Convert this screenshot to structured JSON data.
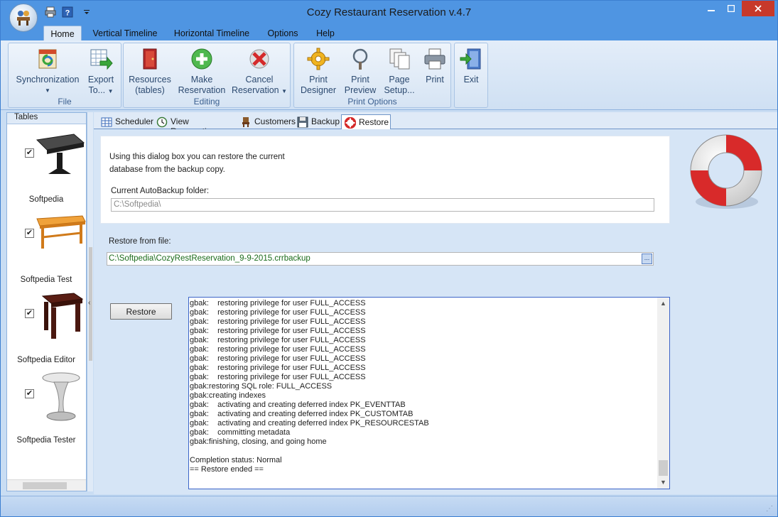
{
  "window": {
    "title": "Cozy Restaurant Reservation v.4.7"
  },
  "ribbon_tabs": [
    "Home",
    "Vertical Timeline",
    "Horizontal Timeline",
    "Options",
    "Help"
  ],
  "ribbon": {
    "groups": {
      "file": "File",
      "editing": "Editing",
      "print_options": "Print Options"
    },
    "buttons": {
      "sync_1": "Synchronization",
      "export_1": "Export",
      "export_2": "To...",
      "resources_1": "Resources",
      "resources_2": "(tables)",
      "make_1": "Make",
      "make_2": "Reservation",
      "cancel_1": "Cancel",
      "cancel_2": "Reservation",
      "printdesigner_1": "Print",
      "printdesigner_2": "Designer",
      "printpreview_1": "Print",
      "printpreview_2": "Preview",
      "pagesetup_1": "Page",
      "pagesetup_2": "Setup...",
      "print": "Print",
      "exit": "Exit"
    }
  },
  "left_panel": {
    "header": "Tables",
    "items": [
      {
        "label": "Softpedia",
        "checked": true
      },
      {
        "label": "Softpedia Test",
        "checked": true
      },
      {
        "label": "Softpedia Editor",
        "checked": true
      },
      {
        "label": "Softpedia Tester",
        "checked": true
      }
    ]
  },
  "content_tabs": [
    "Scheduler",
    "View Reservations",
    "Customers",
    "Backup",
    "Restore"
  ],
  "restore": {
    "info_line1": "Using this dialog box you can restore the current",
    "info_line2": "database from the backup copy.",
    "autobackup_label": "Current AutoBackup folder:",
    "autobackup_value": "C:\\Softpedia\\",
    "restore_from_label": "Restore from file:",
    "restore_file_value": "C:\\Softpedia\\CozyRestReservation_9-9-2015.crrbackup",
    "browse_label": "...",
    "restore_button": "Restore",
    "log": [
      "gbak:    restoring privilege for user FULL_ACCESS",
      "gbak:    restoring privilege for user FULL_ACCESS",
      "gbak:    restoring privilege for user FULL_ACCESS",
      "gbak:    restoring privilege for user FULL_ACCESS",
      "gbak:    restoring privilege for user FULL_ACCESS",
      "gbak:    restoring privilege for user FULL_ACCESS",
      "gbak:    restoring privilege for user FULL_ACCESS",
      "gbak:    restoring privilege for user FULL_ACCESS",
      "gbak:    restoring privilege for user FULL_ACCESS",
      "gbak:restoring SQL role: FULL_ACCESS",
      "gbak:creating indexes",
      "gbak:    activating and creating deferred index PK_EVENTTAB",
      "gbak:    activating and creating deferred index PK_CUSTOMTAB",
      "gbak:    activating and creating deferred index PK_RESOURCESTAB",
      "gbak:    committing metadata",
      "gbak:finishing, closing, and going home",
      "",
      "Completion status: Normal",
      "== Restore ended =="
    ]
  },
  "colors": {
    "accent": "#4f95e2",
    "ribbon": "#dfeaf7",
    "close": "#c7392a"
  }
}
